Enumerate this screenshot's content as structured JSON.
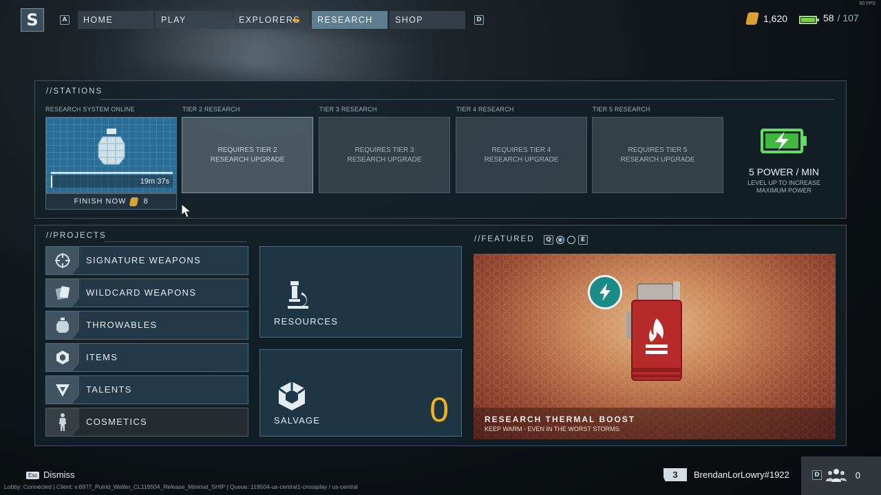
{
  "fps": "60 FPS",
  "nav": {
    "logo": "S",
    "left_key": "A",
    "right_key": "D",
    "tabs": [
      {
        "label": "HOME"
      },
      {
        "label": "PLAY"
      },
      {
        "label": "EXPLORERS"
      },
      {
        "label": "RESEARCH"
      },
      {
        "label": "SHOP"
      }
    ],
    "active_tab": "RESEARCH"
  },
  "wallet": {
    "currency_amount": "1,620",
    "energy_current": "58",
    "energy_max": "/ 107"
  },
  "stations": {
    "title": "//STATIONS",
    "slot1": {
      "label": "RESEARCH SYSTEM ONLINE",
      "timer": "19m 37s",
      "finish_label": "FINISH NOW",
      "finish_cost": "8",
      "progress": 0.05
    },
    "tiers": [
      {
        "label": "TIER 2 RESEARCH",
        "line1": "REQUIRES TIER 2",
        "line2": "RESEARCH UPGRADE"
      },
      {
        "label": "TIER 3 RESEARCH",
        "line1": "REQUIRES TIER 3",
        "line2": "RESEARCH UPGRADE"
      },
      {
        "label": "TIER 4 RESEARCH",
        "line1": "REQUIRES TIER 4",
        "line2": "RESEARCH UPGRADE"
      },
      {
        "label": "TIER 5 RESEARCH",
        "line1": "REQUIRES TIER 5",
        "line2": "RESEARCH UPGRADE"
      }
    ],
    "power": {
      "rate": "5 POWER / MIN",
      "hint_line1": "LEVEL UP TO INCREASE",
      "hint_line2": "MAXIMUM POWER"
    }
  },
  "projects": {
    "title": "//PROJECTS",
    "items": [
      {
        "label": "SIGNATURE WEAPONS",
        "icon": "crosshair-icon"
      },
      {
        "label": "WILDCARD WEAPONS",
        "icon": "cards-icon"
      },
      {
        "label": "THROWABLES",
        "icon": "grenade-icon"
      },
      {
        "label": "ITEMS",
        "icon": "hexagon-icon"
      },
      {
        "label": "TALENTS",
        "icon": "triangle-icon"
      },
      {
        "label": "COSMETICS",
        "icon": "figure-icon"
      }
    ],
    "resources_label": "RESOURCES",
    "salvage_label": "SALVAGE",
    "salvage_count": "0"
  },
  "featured": {
    "title": "//FEATURED",
    "left_key": "Q",
    "right_key": "E",
    "item_title": "RESEARCH THERMAL BOOST",
    "item_subtitle": "KEEP WARM - EVEN IN THE WORST STORMS."
  },
  "footer": {
    "esc_key": "Esc",
    "dismiss_label": "Dismiss",
    "status": "Lobby: Connected | Client: v.6977_Putrid_Walter_CL119504_Release_Minimal_SHIP | Queue: 119504-us-central1-crossplay / us-central",
    "player_level": "3",
    "username": "BrendanLorLowry#1922",
    "party_key": "D",
    "party_count": "0"
  },
  "colors": {
    "accent_gold": "#f0b21e",
    "accent_active_tab": "#5d7e91",
    "power_green": "#7bd443"
  }
}
